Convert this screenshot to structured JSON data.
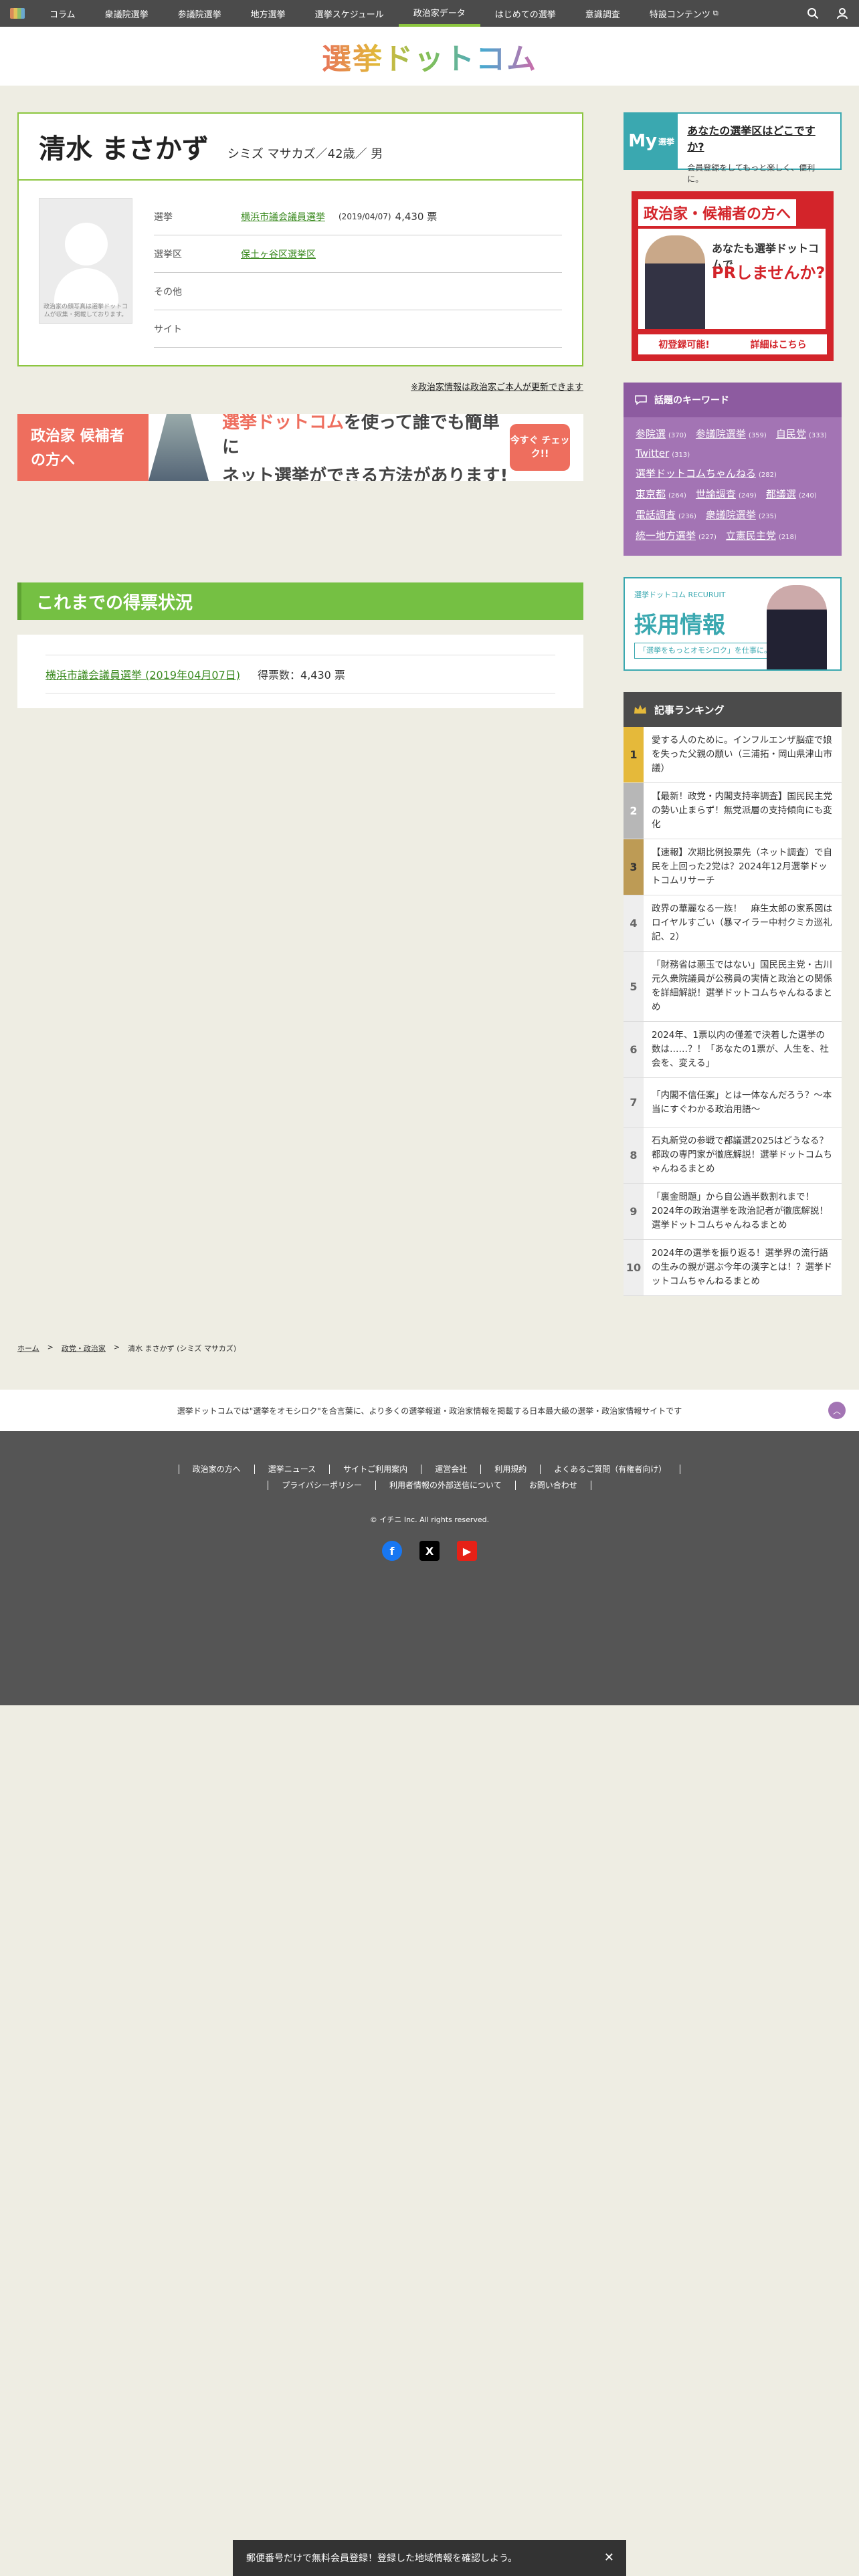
{
  "nav": {
    "items": [
      "コラム",
      "衆議院選挙",
      "参議院選挙",
      "地方選挙",
      "選挙スケジュール",
      "政治家データ",
      "はじめての選挙",
      "意識調査",
      "特設コンテンツ"
    ],
    "active_index": 5
  },
  "header": {
    "logo": "選挙ドットコム"
  },
  "profile": {
    "name": "清水 まさかず",
    "kana_age_gender": "シミズ マサカズ／42歳／ 男",
    "photo_note": "政治家の顔写真は選挙ドットコムが収集・掲載しております。",
    "rows": [
      {
        "label": "選挙",
        "link": "横浜市議会議員選挙",
        "date": "(2019/04/07)",
        "votes": "4,430 票"
      },
      {
        "label": "選挙区",
        "link": "保土ヶ谷区選挙区"
      },
      {
        "label": "その他"
      },
      {
        "label": "サイト"
      }
    ],
    "update_note": "※政治家情報は政治家ご本人が更新できます"
  },
  "promo": {
    "left": "政治家 候補者の方へ",
    "line1_brand": "選挙ドットコム",
    "line1_rest": "を使って誰でも簡単に",
    "line2": "ネット選挙ができる方法があります!",
    "button": "今すぐ チェック!!"
  },
  "votes_section": {
    "title": "これまでの得票状況",
    "election_link": "横浜市議会議員選挙 (2019年04月07日)",
    "count": "得票数：4,430 票"
  },
  "sidebar": {
    "my": {
      "badge": "My",
      "badge_sub": "選挙",
      "question": "あなたの選挙区はどこですか?",
      "sub": "会員登録をしてもっと楽しく、便利に。"
    },
    "cand_ad": {
      "tag": "政治家・候補者の方へ",
      "l1": "あなたも選挙ドットコムで",
      "l2": "PRしませんか?",
      "b1": "初登録可能!",
      "b2": "詳細はこちら"
    },
    "keywords": {
      "title": "話題のキーワード",
      "items": [
        {
          "word": "参院選",
          "count": "(370)"
        },
        {
          "word": "参議院選挙",
          "count": "(359)"
        },
        {
          "word": "自民党",
          "count": "(333)"
        },
        {
          "word": "Twitter",
          "count": "(313)"
        },
        {
          "word": "選挙ドットコムちゃんねる",
          "count": "(282)"
        },
        {
          "word": "東京都",
          "count": "(264)"
        },
        {
          "word": "世論調査",
          "count": "(249)"
        },
        {
          "word": "都議選",
          "count": "(240)"
        },
        {
          "word": "電話調査",
          "count": "(236)"
        },
        {
          "word": "衆議院選挙",
          "count": "(235)"
        },
        {
          "word": "統一地方選挙",
          "count": "(227)"
        },
        {
          "word": "立憲民主党",
          "count": "(218)"
        }
      ]
    },
    "recruit": {
      "label": "選挙ドットコム RECURUIT",
      "title": "採用情報",
      "sub": "「選挙をもっとオモシロク」を仕事に。"
    },
    "ranking": {
      "title": "記事ランキング",
      "items": [
        {
          "no": "1",
          "text": "愛する人のために。インフルエンザ脳症で娘を失った父親の願い（三浦拓・岡山県津山市議）"
        },
        {
          "no": "2",
          "text": "【最新！政党・内閣支持率調査】国民民主党の勢い止まらず！無党派層の支持傾向にも変化"
        },
        {
          "no": "3",
          "text": "【速報】次期比例投票先（ネット調査）で自民を上回った2党は？2024年12月選挙ドットコムリサーチ"
        },
        {
          "no": "4",
          "text": "政界の華麗なる一族！　麻生太郎の家系図はロイヤルすごい（暴マイラー中村クミカ巡礼記、2）"
        },
        {
          "no": "5",
          "text": "「財務省は悪玉ではない」国民民主党・古川元久衆院議員が公務員の実情と政治との関係を詳細解説！選挙ドットコムちゃんねるまとめ"
        },
        {
          "no": "6",
          "text": "2024年、1票以内の僅差で決着した選挙の数は……？！「あなたの1票が、人生を、社会を、変える」"
        },
        {
          "no": "7",
          "text": "「内閣不信任案」とは一体なんだろう？〜本当にすぐわかる政治用語〜"
        },
        {
          "no": "8",
          "text": "石丸新党の参戦で都議選2025はどうなる？都政の専門家が徹底解説！選挙ドットコムちゃんねるまとめ"
        },
        {
          "no": "9",
          "text": "「裏金問題」から自公過半数割れまで！2024年の政治選挙を政治記者が徹底解説！選挙ドットコムちゃんねるまとめ"
        },
        {
          "no": "10",
          "text": "2024年の選挙を振り返る！選挙界の流行語の生みの親が選ぶ今年の漢字とは！？選挙ドットコムちゃんねるまとめ"
        }
      ]
    }
  },
  "breadcrumb": {
    "home": "ホーム",
    "parent": "政党・政治家",
    "current": "清水 まさかず (シミズ マサカズ)",
    "sep": ">"
  },
  "tagline": "選挙ドットコムでは\"選挙をオモシロク\"を合言葉に、より多くの選挙報道・政治家情報を掲載する日本最大級の選挙・政治家情報サイトです",
  "footer": {
    "links": [
      "政治家の方へ",
      "選挙ニュース",
      "サイトご利用案内",
      "運営会社",
      "利用規約",
      "よくあるご質問（有権者向け）",
      "プライバシーポリシー",
      "利用者情報の外部送信について",
      "お問い合わせ"
    ],
    "copyright": "© イチニ Inc. All rights reserved.",
    "social": {
      "fb": "f",
      "x": "X",
      "yt": "▶"
    }
  },
  "bottom_banner": {
    "text": "郵便番号だけで無料会員登録！登録した地域情報を確認しよう。",
    "close": "✕"
  },
  "colors": {
    "accent": "#8cc63f",
    "nav": "#4b4b4b",
    "keyword_bg": "#a374b4",
    "promo": "#ee6e5e",
    "my": "#3aa8b0"
  }
}
